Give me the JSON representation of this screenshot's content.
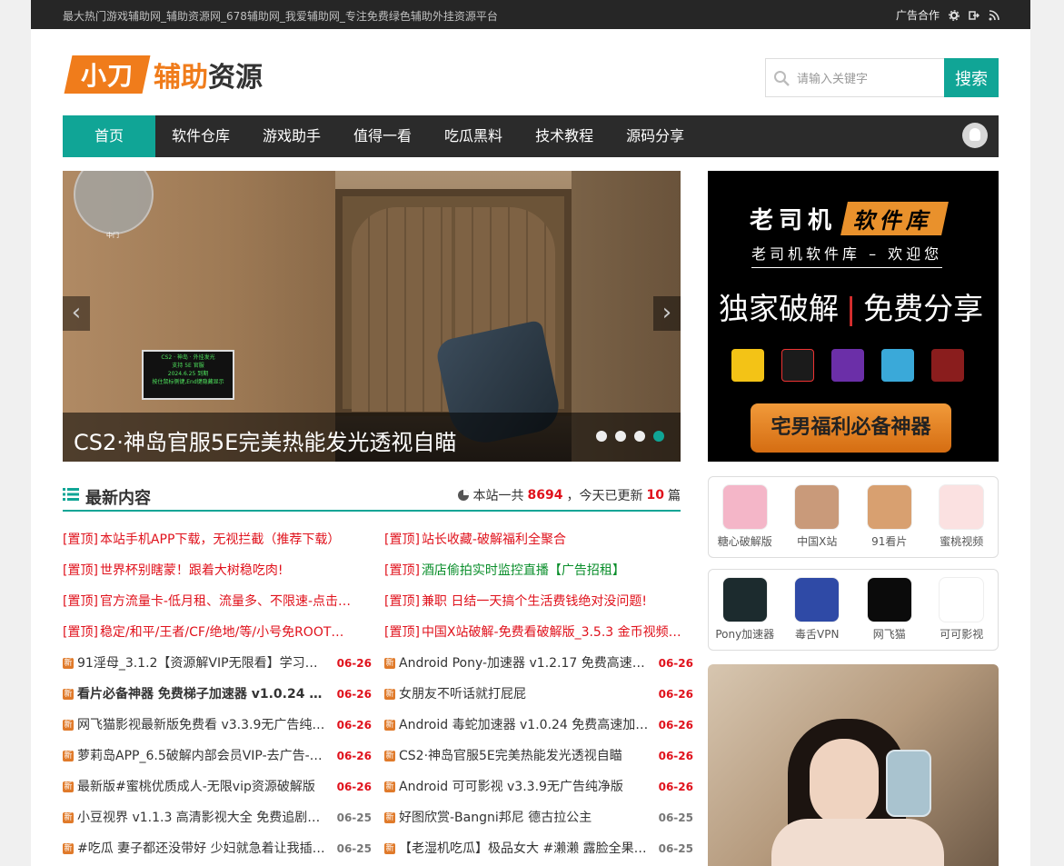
{
  "topbar": {
    "tagline": "最大热门游戏辅助网_辅助资源网_678辅助网_我爱辅助网_专注免费绿色辅助外挂资源平台",
    "ad_link": "广告合作",
    "icons": [
      "settings-icon",
      "login-icon",
      "rss-icon"
    ]
  },
  "logo": {
    "badge": "小刀",
    "part1": "辅助",
    "part2": "资源"
  },
  "search": {
    "placeholder": "请输入关键字",
    "button": "搜索"
  },
  "nav": {
    "items": [
      "首页",
      "软件仓库",
      "游戏助手",
      "值得一看",
      "吃瓜黑料",
      "技术教程",
      "源码分享"
    ],
    "active": 0
  },
  "slider": {
    "caption": "CS2·神岛官服5E完美热能发光透视自瞄",
    "prev": "‹",
    "next": "›",
    "slides": 4,
    "active_slide": 4,
    "radar_label": "中门",
    "menu_lines": [
      "CS2 · 神岛 · 外挂发光",
      "支持 5E 官服",
      "2024.6.25 到期",
      "按住鼠标侧键,End键隐藏显示"
    ]
  },
  "ad": {
    "title_a": "老司机",
    "title_b": "软件库",
    "subtitle": "老司机软件库 – 欢迎您",
    "slogan_a": "独家破解",
    "slogan_sep": "|",
    "slogan_b": "免费分享",
    "button": "宅男福利必备神器"
  },
  "latest": {
    "title": "最新内容",
    "stat_prefix": "本站一共",
    "total": "8694",
    "stat_mid": "，今天已更新",
    "today": "10",
    "stat_suffix": "篇"
  },
  "list_left": [
    {
      "pin": "[置顶]",
      "text": "本站手机APP下载，无视拦截（推荐下载）",
      "style": "red"
    },
    {
      "pin": "[置顶]",
      "text": "世界杯别瞎蒙！跟着大树稳吃肉!",
      "style": "red"
    },
    {
      "pin": "[置顶]",
      "text": "官方流量卡-低月租、流量多、不限速-点击…",
      "style": "red"
    },
    {
      "pin": "[置顶]",
      "text": "稳定/和平/王者/CF/绝地/等/小号免ROOT…",
      "style": "red"
    },
    {
      "new": "新",
      "text": "91淫母_3.1.2【资源解VIP无限看】学习资…",
      "date": "06-26",
      "style": ""
    },
    {
      "new": "新",
      "text": "看片必备神器 免费梯子加速器 v1.0.24 超…",
      "date": "06-26",
      "style": "bold"
    },
    {
      "new": "新",
      "text": "网飞猫影视最新版免费看 v3.3.9无广告纯…",
      "date": "06-26",
      "style": ""
    },
    {
      "new": "新",
      "text": "萝莉岛APP_6.5破解内部会员VIP-去广告-…",
      "date": "06-26",
      "style": ""
    },
    {
      "new": "新",
      "text": "最新版#蜜桃优质成人-无限vip资源破解版",
      "date": "06-26",
      "style": ""
    },
    {
      "new": "新",
      "text": "小豆视界 v1.1.3 高清影视大全 免费追剧…",
      "date": "06-25",
      "style": ""
    },
    {
      "new": "新",
      "text": "#吃瓜 妻子都还没带好 少妇就急着让我插…",
      "date": "06-25",
      "style": ""
    }
  ],
  "list_right": [
    {
      "pin": "[置顶]",
      "text": "站长收藏-破解福利全聚合",
      "style": "red"
    },
    {
      "pin": "[置顶]",
      "text": "酒店偷拍实时监控直播【广告招租】",
      "style": "green"
    },
    {
      "pin": "[置顶]",
      "text": "兼职 日结一天搞个生活费钱绝对没问题!",
      "style": "red"
    },
    {
      "pin": "[置顶]",
      "text": "中国X站破解-免费看破解版_3.5.3 金币视频…",
      "style": "red"
    },
    {
      "new": "新",
      "text": "Android Pony-加速器 v1.2.17 免费高速…",
      "date": "06-26",
      "style": ""
    },
    {
      "new": "新",
      "text": "女朋友不听话就打屁屁",
      "date": "06-26",
      "style": ""
    },
    {
      "new": "新",
      "text": "Android 毒蛇加速器 v1.0.24 免费高速加…",
      "date": "06-26",
      "style": ""
    },
    {
      "new": "新",
      "text": "CS2·神岛官服5E完美热能发光透视自瞄",
      "date": "06-26",
      "style": ""
    },
    {
      "new": "新",
      "text": "Android 可可影视 v3.3.9无广告纯净版",
      "date": "06-26",
      "style": ""
    },
    {
      "new": "新",
      "text": "好图欣赏-Bangni邦尼 德古拉公主",
      "date": "06-25",
      "style": ""
    },
    {
      "new": "新",
      "text": "【老湿机吃瓜】极品女大 #濑濑 露脸全果…",
      "date": "06-25",
      "style": ""
    }
  ],
  "apps_row1": [
    {
      "name": "糖心破解版",
      "color": "#f4b6c8"
    },
    {
      "name": "中国X站",
      "color": "#c99a7a"
    },
    {
      "name": "91看片",
      "color": "#d8a070"
    },
    {
      "name": "蜜桃视频",
      "color": "#fbe1e1"
    }
  ],
  "apps_row2": [
    {
      "name": "Pony加速器",
      "color": "#1c2b2e"
    },
    {
      "name": "毒舌VPN",
      "color": "#2f4aa6"
    },
    {
      "name": "网飞猫",
      "color": "#0b0b0b"
    },
    {
      "name": "可可影视",
      "color": "#ffffff"
    }
  ],
  "colors": {
    "accent": "#10a596",
    "orange": "#f07c1b",
    "red": "#e0121c",
    "green": "#0a8e2b",
    "dark": "#2b2b2b"
  }
}
